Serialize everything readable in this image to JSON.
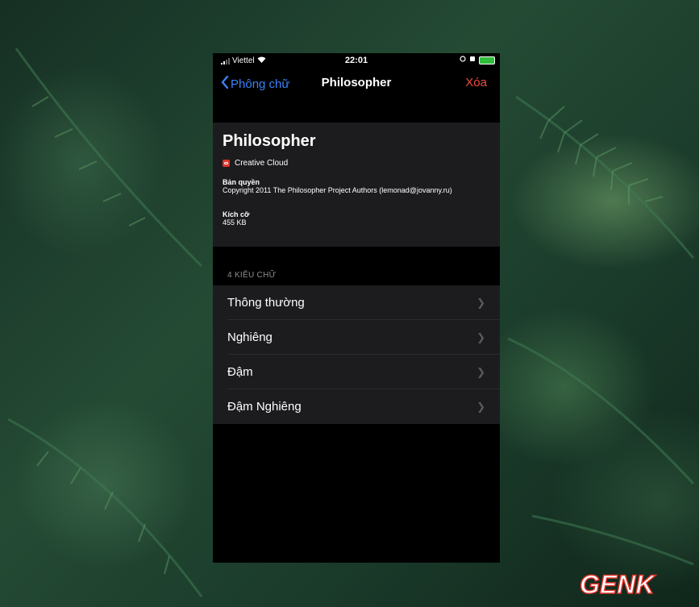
{
  "status_bar": {
    "carrier": "Viettel",
    "time": "22:01"
  },
  "nav": {
    "back_label": "Phông chữ",
    "title": "Philosopher",
    "action_label": "Xóa"
  },
  "font_info": {
    "name": "Philosopher",
    "source_app": "Creative Cloud",
    "copyright_label": "Bản quyền",
    "copyright_text": "Copyright 2011 The Philosopher Project Authors (lemonad@jovanny.ru)",
    "size_label": "Kích cỡ",
    "size_value": "455 KB"
  },
  "styles_section": {
    "header": "4 KIỂU CHỮ",
    "items": [
      {
        "label": "Thông thường"
      },
      {
        "label": "Nghiêng"
      },
      {
        "label": "Đậm"
      },
      {
        "label": "Đậm Nghiêng"
      }
    ]
  },
  "watermark": "GENK",
  "colors": {
    "accent": "#3a82f7",
    "destructive": "#ef4a3e",
    "cell_bg": "#1c1c1e",
    "badge": "#e0332b"
  }
}
